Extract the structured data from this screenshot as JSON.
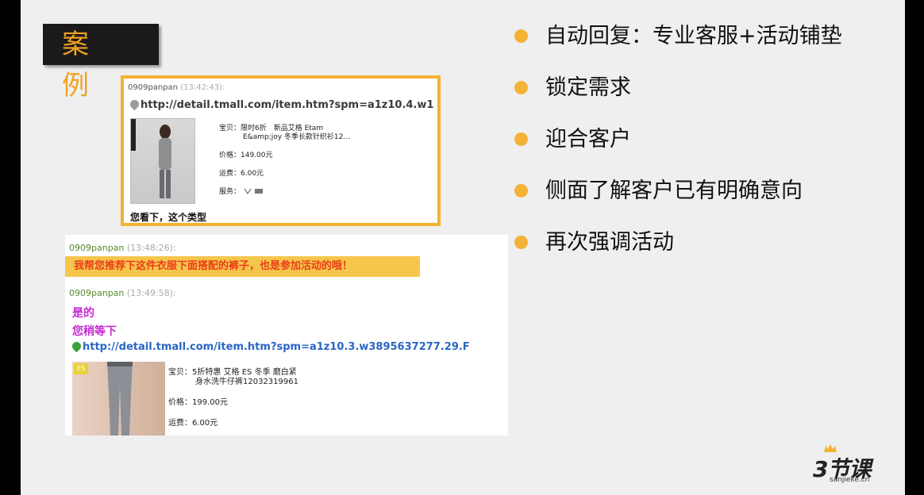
{
  "badge": {
    "label": "案 例"
  },
  "chat1": {
    "sender": "0909panpan",
    "time": "(13:42:43):",
    "link": "http://detail.tmall.com/item.htm?spm=a1z10.4.w1",
    "product": {
      "title_line1": "宝贝：限时6折　新品艾格 Etam",
      "title_line2": "E&amp;joy 冬季长款针织衫12…",
      "price": "价格：149.00元",
      "shipping": "运费：6.00元",
      "service_label": "服务："
    },
    "message": "您看下，这个类型"
  },
  "chat2": {
    "msg1_sender": "0909panpan",
    "msg1_time": "(13:48:26):",
    "highlight": "我帮您推荐下这件衣服下面搭配的裤子，也是参加活动的哦！",
    "msg2_sender": "0909panpan",
    "msg2_time": "(13:49:58):",
    "line1": "是的",
    "line2": "您稍等下",
    "link": "http://detail.tmall.com/item.htm?spm=a1z10.3.w3895637277.29.F",
    "product": {
      "tag": "ES",
      "title_line1": "宝贝：5折特惠 艾格 ES 冬季 磨白紧",
      "title_line2": "身水洗牛仔裤12032319961",
      "price": "价格：199.00元",
      "shipping": "运费：6.00元"
    }
  },
  "bullets": [
    "自动回复：专业客服+活动铺垫",
    "锁定需求",
    "迎合客户",
    "侧面了解客户已有明确意向",
    "再次强调活动"
  ],
  "logo": {
    "main": "3节课",
    "sub": "sanjieke.cn"
  },
  "colors": {
    "accent": "#f4b236",
    "badge_text": "#f2a224",
    "highlight_bg": "#f6c64c",
    "highlight_text": "#ea3d17",
    "purple": "#c42bd2",
    "link_blue": "#2a66c4"
  }
}
